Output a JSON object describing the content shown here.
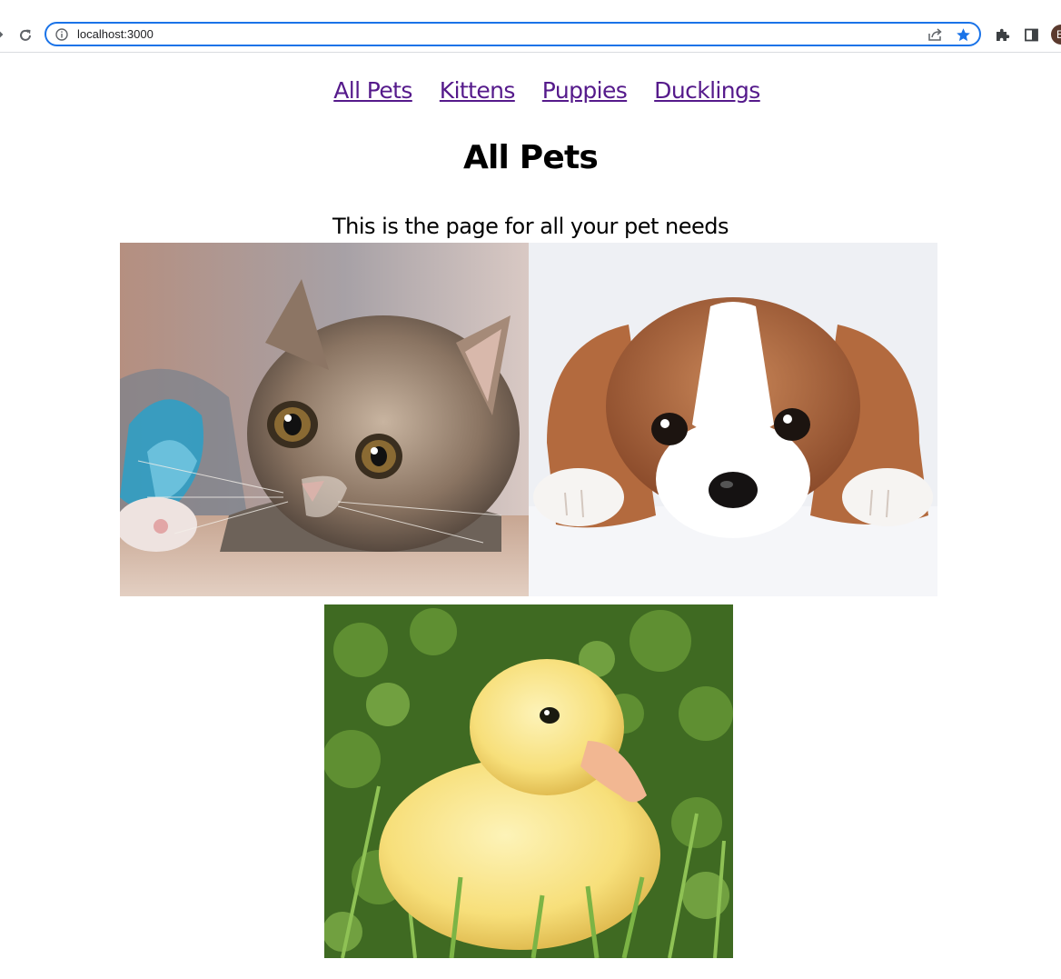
{
  "browser": {
    "url": "localhost:3000",
    "avatar_initial": "E",
    "accent_color": "#1a73e8",
    "icons": [
      "back-arrow-icon",
      "reload-icon",
      "info-icon",
      "share-icon",
      "star-icon",
      "extensions-icon",
      "side-panel-icon"
    ]
  },
  "nav": {
    "links": [
      {
        "label": "All Pets"
      },
      {
        "label": "Kittens"
      },
      {
        "label": "Puppies"
      },
      {
        "label": "Ducklings"
      }
    ],
    "link_color": "#551a8b"
  },
  "main": {
    "title": "All Pets",
    "subtitle": "This is the page for all your pet needs",
    "images": [
      "kitten-photo",
      "puppy-photo",
      "duckling-photo"
    ]
  }
}
